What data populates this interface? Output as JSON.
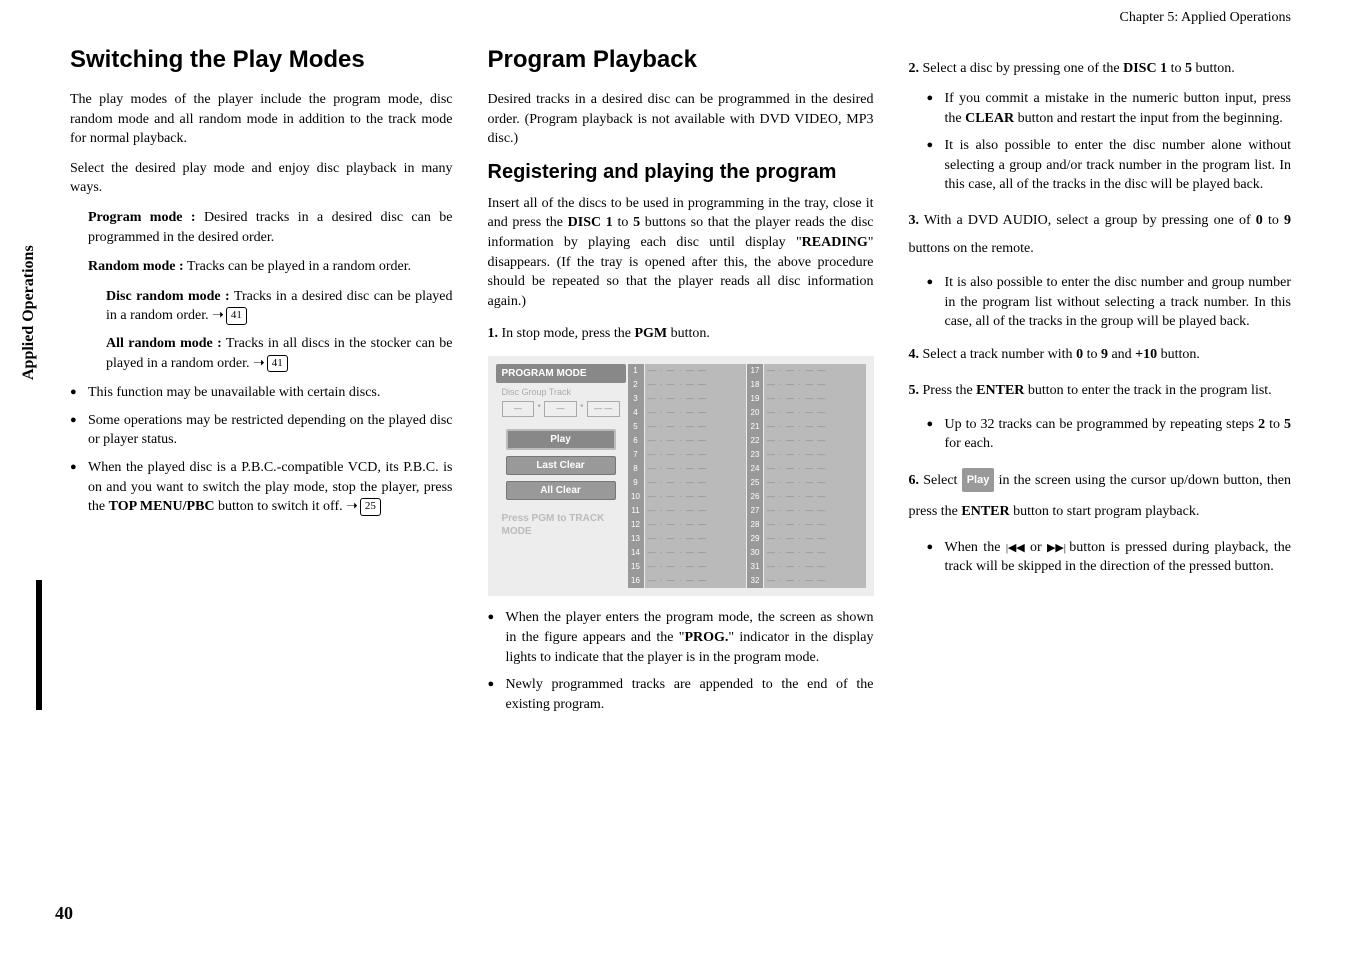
{
  "chapter_header": "Chapter 5: Applied Operations",
  "side_tab": "Applied Operations",
  "page_number": "40",
  "col1": {
    "h1": "Switching the Play Modes",
    "p1": "The play modes of the player include the program mode, disc random mode and all random mode in addition to the track mode for normal playback.",
    "p2": "Select the desired play mode and enjoy disc playback in many ways.",
    "program_mode_label": "Program mode :",
    "program_mode_text": " Desired tracks in a desired disc can be programmed in the desired order.",
    "random_mode_label": "Random mode :",
    "random_mode_text": " Tracks can be played in a random order.",
    "disc_random_label": "Disc random mode :",
    "disc_random_text": " Tracks in a desired disc can be played in a random order.    ",
    "disc_random_ref": "41",
    "all_random_label": "All random mode :",
    "all_random_text": " Tracks in all discs in the stocker can be played in a random order.    ",
    "all_random_ref": "41",
    "bullet1": "This function may be unavailable with certain discs.",
    "bullet2": "Some operations may be restricted depending on the played disc or player status.",
    "bullet3a": "When the played disc is a P.B.C.-compatible VCD, its P.B.C. is on and you want to switch the play mode, stop the player,  press the ",
    "bullet3b": "TOP MENU/PBC",
    "bullet3c": " button to switch it off.    ",
    "bullet3_ref": "25"
  },
  "col2": {
    "h1": "Program Playback",
    "p1": "Desired tracks in a desired disc can be programmed in the desired order. (Program playback is not available with DVD VIDEO, MP3 disc.)",
    "h2": "Registering and playing the program",
    "p2a": "Insert all of the discs to be used in programming in the tray, close it and press the ",
    "p2b": "DISC 1",
    "p2c": " to ",
    "p2d": "5",
    "p2e": " buttons so that the player reads the disc information by playing each disc until display \"",
    "p2f": "READING",
    "p2g": "\" disappears. (If the tray is opened after this, the above procedure should be repeated so that the player reads all disc information again.)",
    "step1_num": "1.",
    "step1_text_a": " In stop mode, press the ",
    "step1_text_b": "PGM",
    "step1_text_c": " button.",
    "screen": {
      "title": "PROGRAM MODE",
      "cols_label": "Disc   Group   Track",
      "play": "Play",
      "last_clear": "Last Clear",
      "all_clear": "All Clear",
      "footer": "Press PGM to TRACK MODE"
    },
    "bullet1a": "When the player enters the program mode, the screen as shown in the figure appears and the \"",
    "bullet1b": "PROG.",
    "bullet1c": "\" indicator in the display lights to indicate that the player is in the program mode.",
    "bullet2": "Newly programmed tracks are appended to the end of the existing program."
  },
  "col3": {
    "step2_num": "2.",
    "step2a": " Select a disc by pressing one of the ",
    "step2b": "DISC 1",
    "step2c": " to ",
    "step2d": "5",
    "step2e": " button.",
    "s2_bullet1a": "If you commit a mistake in the numeric button input, press the ",
    "s2_bullet1b": "CLEAR",
    "s2_bullet1c": " button and restart the input from the beginning.",
    "s2_bullet2": "It is also possible to enter the disc number alone without selecting a group and/or track number in the program list. In this case, all of the tracks in the disc will be played back.",
    "step3_num": "3.",
    "step3a": " With a DVD AUDIO, select a group by pressing one of ",
    "step3b": "0",
    "step3c": " to ",
    "step3d": "9",
    "step3e": " buttons on the remote.",
    "s3_bullet1": "It is also possible to enter the disc number and group number in the program list without selecting a track number. In this case, all of the tracks in the group will be played back.",
    "step4_num": "4.",
    "step4a": " Select a track number with ",
    "step4b": "0",
    "step4c": " to ",
    "step4d": "9",
    "step4e": " and ",
    "step4f": "+10",
    "step4g": " button.",
    "step5_num": "5.",
    "step5a": " Press the ",
    "step5b": "ENTER",
    "step5c": " button to enter the track in the program list.",
    "s5_bullet1a": "Up to 32 tracks can be programmed by repeating steps ",
    "s5_bullet1b": "2",
    "s5_bullet1c": " to ",
    "s5_bullet1d": "5",
    "s5_bullet1e": " for each.",
    "step6_num": "6.",
    "step6a": " Select ",
    "step6_play": "Play",
    "step6b": " in the screen using the cursor up/down button, then press the ",
    "step6c": "ENTER",
    "step6d": " button to start program playback.",
    "s6_bullet1a": "When the ",
    "s6_prev": "|◀◀",
    "s6_bullet1b": " or ",
    "s6_next": "▶▶|",
    "s6_bullet1c": " button is pressed during playback, the track will be skipped in the direction of the pressed button."
  }
}
